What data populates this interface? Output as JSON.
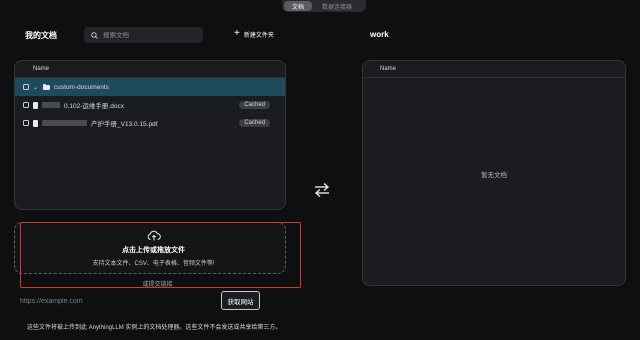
{
  "top_tabs": {
    "documents": "文档",
    "data_connectors": "数据连接器"
  },
  "left": {
    "title": "我的文档",
    "search_placeholder": "搜索文档",
    "new_folder_label": "新建文件夹",
    "column_name": "Name",
    "rows": [
      {
        "name": "custom-documents",
        "type": "folder"
      },
      {
        "name": "0.102-运维手册.docx",
        "status": "Cached",
        "type": "file"
      },
      {
        "name": "产护手册_V13.0.15.pdf",
        "status": "Cached",
        "type": "file"
      }
    ]
  },
  "right": {
    "title": "work",
    "column_name": "Name",
    "empty_text": "暂无文档"
  },
  "upload": {
    "title": "点击上传或拖放文件",
    "subtitle": "支持文本文件、CSV、电子表格、音频文件等!",
    "or_link": "或提交链接"
  },
  "url": {
    "placeholder": "https://example.com",
    "fetch_label": "获取网站"
  },
  "footer_note": "这些文件将被上传到此 AnythingLLM 实例上的文档处理器。这些文件不会发送或共享给第三方。",
  "icons": {
    "search": "search-icon",
    "plus": "plus-icon",
    "swap": "swap-arrows-icon",
    "cloud": "cloud-upload-icon",
    "folder": "folder-icon",
    "document": "document-icon",
    "chevron": "chevron-down-icon"
  },
  "colors": {
    "background": "#0e0f11",
    "panel": "#1b1c1f",
    "highlight_row": "#1e4a5c",
    "annotation_box": "#d23a2a"
  }
}
